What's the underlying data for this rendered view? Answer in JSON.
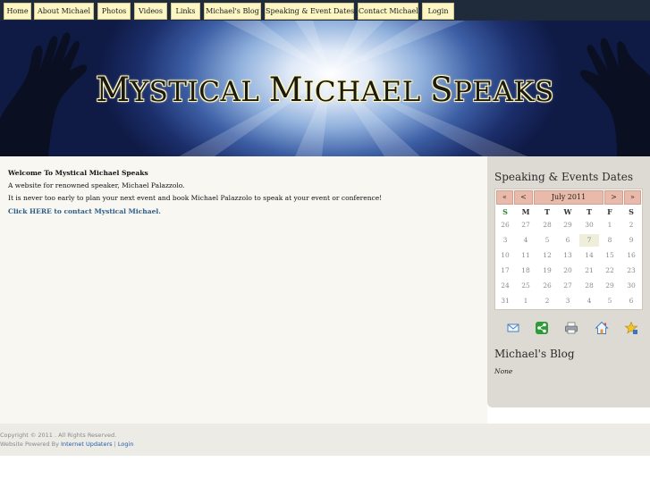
{
  "nav": {
    "items": [
      {
        "label": "Home"
      },
      {
        "label": "About Michael"
      },
      {
        "label": "Photos"
      },
      {
        "label": "Videos"
      },
      {
        "label": "Links"
      },
      {
        "label": "Michael's Blog"
      },
      {
        "label": "Speaking & Event Dates"
      },
      {
        "label": "Contact Michael"
      },
      {
        "label": "Login"
      }
    ]
  },
  "banner": {
    "title_parts": [
      "M",
      "YSTICAL ",
      "M",
      "ICHAEL ",
      "S",
      "PEAKS"
    ]
  },
  "main": {
    "welcome_title": "Welcome To Mystical Michael Speaks",
    "line1": "A website for renowned speaker, Michael Palazzolo.",
    "line2": "It is never too early to plan your next event and book Michael Palazzolo to speak at your event or conference!",
    "contact_link": "Click HERE to contact Mystical Michael."
  },
  "sidebar": {
    "events_heading": "Speaking & Events Dates",
    "calendar": {
      "prev_year": "«",
      "prev_month": "<",
      "month_label": "July 2011",
      "next_month": ">",
      "next_year": "»",
      "weekdays": [
        "S",
        "M",
        "T",
        "W",
        "T",
        "F",
        "S"
      ],
      "weeks": [
        [
          "26",
          "27",
          "28",
          "29",
          "30",
          "1",
          "2"
        ],
        [
          "3",
          "4",
          "5",
          "6",
          "7",
          "8",
          "9"
        ],
        [
          "10",
          "11",
          "12",
          "13",
          "14",
          "15",
          "16"
        ],
        [
          "17",
          "18",
          "19",
          "20",
          "21",
          "22",
          "23"
        ],
        [
          "24",
          "25",
          "26",
          "27",
          "28",
          "29",
          "30"
        ],
        [
          "31",
          "1",
          "2",
          "3",
          "4",
          "5",
          "6"
        ]
      ],
      "highlighted_day": "7"
    },
    "share_icons": [
      "email-icon",
      "share-icon",
      "print-icon",
      "home-icon",
      "favorite-icon"
    ],
    "blog_heading": "Michael's Blog",
    "blog_text": "None"
  },
  "footer": {
    "copyright": "Copyright © 2011 . All Rights Reserved.",
    "powered_prefix": "Website Powered By",
    "powered_link": "Internet Updaters",
    "separator": "|",
    "login_link": "Login"
  },
  "colors": {
    "nav_bg": "#1f2b3a",
    "nav_button": "#fcf6c4",
    "calendar_header": "#e9b9a9",
    "sidebar_bg": "#dcdad2",
    "link": "#2a5d8a"
  }
}
